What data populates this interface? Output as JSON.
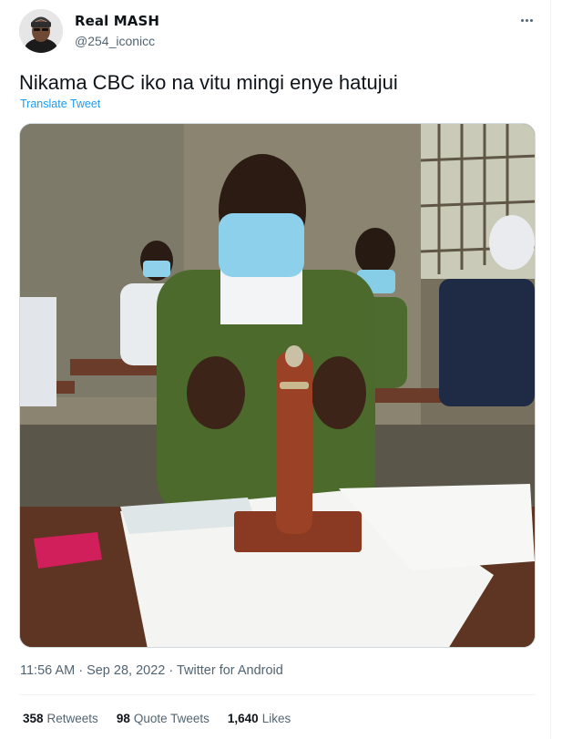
{
  "author": {
    "display_name": "Real MASH",
    "handle": "@254_iconicc",
    "avatar_icon": "user-avatar-photo"
  },
  "more_icon": "more-options-icon",
  "tweet": {
    "text": "Nikama CBC iko na vitu mingi enye hatujui",
    "translate_label": "Translate Tweet"
  },
  "meta": {
    "timestamp": "11:56 AM · Sep 28, 2022 · Twitter for Android"
  },
  "stats": {
    "retweets_count": "358",
    "retweets_label": "Retweets",
    "quotes_count": "98",
    "quotes_label": "Quote Tweets",
    "likes_count": "1,640",
    "likes_label": "Likes"
  },
  "colors": {
    "accent": "#1d9bf0",
    "text": "#0f1419",
    "secondary": "#536471",
    "border": "#eff3f4"
  }
}
